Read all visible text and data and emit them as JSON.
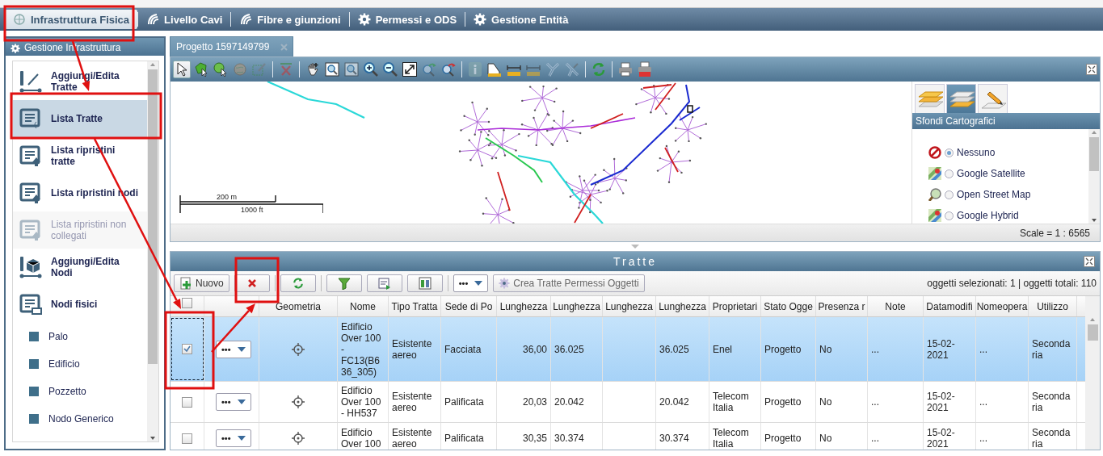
{
  "nav": {
    "items": [
      {
        "label": "Infrastruttura Fisica",
        "kind": "network",
        "selected": true
      },
      {
        "label": "Livello Cavi",
        "kind": "cable",
        "selected": false
      },
      {
        "label": "Fibre e giunzioni",
        "kind": "cable",
        "selected": false
      },
      {
        "label": "Permessi e ODS",
        "kind": "gear",
        "selected": false
      },
      {
        "label": "Gestione Entità",
        "kind": "gear",
        "selected": false
      }
    ]
  },
  "sidebar": {
    "title": "Gestione Infrastruttura",
    "items": [
      {
        "label": "Aggiungi/Edita Tratte",
        "kind": "edit-line",
        "selected": false,
        "disabled": false
      },
      {
        "label": "Lista Tratte",
        "kind": "list",
        "selected": true,
        "disabled": false
      },
      {
        "label": "Lista ripristini tratte",
        "kind": "list-up",
        "selected": false,
        "disabled": false
      },
      {
        "label": "Lista ripristini nodi",
        "kind": "list-up",
        "selected": false,
        "disabled": false
      },
      {
        "label": "Lista ripristini non collegati",
        "kind": "list-up",
        "selected": false,
        "disabled": true
      },
      {
        "label": "Aggiungi/Edita Nodi",
        "kind": "edit-node",
        "selected": false,
        "disabled": false
      },
      {
        "label": "Nodi fisici",
        "kind": "list-box",
        "selected": false,
        "disabled": false
      },
      {
        "label": "Palo",
        "kind": "node-type",
        "selected": false,
        "disabled": false
      },
      {
        "label": "Edificio",
        "kind": "node-type",
        "selected": false,
        "disabled": false
      },
      {
        "label": "Pozzetto",
        "kind": "node-type",
        "selected": false,
        "disabled": false
      },
      {
        "label": "Nodo Generico",
        "kind": "node-type",
        "selected": false,
        "disabled": false
      }
    ]
  },
  "map": {
    "tab": {
      "label": "Progetto 1597149799"
    },
    "tool_groups": [
      [
        {
          "kind": "pointer",
          "selected": true,
          "disabled": false
        },
        {
          "kind": "select-polygon",
          "selected": false,
          "disabled": false
        },
        {
          "kind": "select-circle",
          "selected": false,
          "disabled": false
        },
        {
          "kind": "globe",
          "selected": false,
          "disabled": true
        },
        {
          "kind": "brush",
          "selected": false,
          "disabled": true
        }
      ],
      [
        {
          "kind": "clear",
          "selected": false,
          "disabled": true
        }
      ],
      [
        {
          "kind": "hand",
          "selected": false,
          "disabled": false
        },
        {
          "kind": "zoom-box",
          "selected": false,
          "disabled": false
        },
        {
          "kind": "zoom-box",
          "selected": false,
          "disabled": true
        },
        {
          "kind": "zoom-in",
          "selected": false,
          "disabled": false
        },
        {
          "kind": "zoom-out",
          "selected": false,
          "disabled": false
        },
        {
          "kind": "expand",
          "selected": false,
          "disabled": false
        },
        {
          "kind": "prev",
          "selected": false,
          "disabled": true
        },
        {
          "kind": "next",
          "selected": false,
          "disabled": false
        }
      ],
      [
        {
          "kind": "info",
          "selected": false,
          "disabled": true
        },
        {
          "kind": "area",
          "selected": false,
          "disabled": false
        },
        {
          "kind": "ruler",
          "selected": false,
          "disabled": false
        },
        {
          "kind": "ruler",
          "selected": false,
          "disabled": true
        },
        {
          "kind": "branch",
          "selected": false,
          "disabled": true
        },
        {
          "kind": "branch2",
          "selected": false,
          "disabled": true
        }
      ],
      [
        {
          "kind": "refresh",
          "selected": false,
          "disabled": false
        }
      ],
      [
        {
          "kind": "printer",
          "selected": false,
          "disabled": false
        },
        {
          "kind": "pdf",
          "selected": false,
          "disabled": false
        }
      ]
    ],
    "scale_bar": {
      "top": "200 m",
      "bottom": "1000 ft"
    },
    "scale": "Scale = 1 : 6565",
    "layers": {
      "tabs": [
        {
          "kind": "layers",
          "selected": false
        },
        {
          "kind": "basemaps",
          "selected": true
        },
        {
          "kind": "edit",
          "selected": false
        }
      ],
      "title": "Sfondi Cartografici",
      "basemaps": [
        {
          "label": "Nessuno",
          "kind": "none",
          "selected": true
        },
        {
          "label": "Google Satellite",
          "kind": "map",
          "selected": false
        },
        {
          "label": "Open Street Map",
          "kind": "search-map",
          "selected": false
        },
        {
          "label": "Google Hybrid",
          "kind": "map",
          "selected": false
        }
      ]
    }
  },
  "grid": {
    "title": "Tratte",
    "toolbar": {
      "new_label": "Nuovo",
      "menu_label": "•••",
      "create_label": "Crea Tratte Permessi Oggetti"
    },
    "status": "oggetti selezionati: 1 | oggetti totali: 110",
    "all_checked": false,
    "columns": [
      "Geometria",
      "Nome",
      "Tipo Tratta",
      "Sede di Po",
      "Lunghezza",
      "Lunghezza",
      "Lunghezza",
      "Lunghezza",
      "Proprietari",
      "Stato Ogge",
      "Presenza r",
      "Note",
      "Datamodifi",
      "Nomeopera",
      "Utilizzo"
    ],
    "rows": [
      {
        "selected": true,
        "checked": true,
        "menu": "•••",
        "cells": [
          "",
          "Edificio Over 100 - FC13(B636_305)",
          "Esistente aereo",
          "Facciata",
          "36,00",
          "36.025",
          "",
          "36.025",
          "Enel",
          "Progetto",
          "No",
          "...",
          "15-02-2021",
          "...",
          "Secondaria"
        ]
      },
      {
        "selected": false,
        "checked": false,
        "menu": "•••",
        "cells": [
          "",
          "Edificio Over 100 - HH537",
          "Esistente aereo",
          "Palificata",
          "20,03",
          "20.042",
          "",
          "20.042",
          "Telecom Italia",
          "Progetto",
          "No",
          "...",
          "15-02-2021",
          "...",
          "Secondaria"
        ]
      },
      {
        "selected": false,
        "checked": false,
        "menu": "•••",
        "cells": [
          "",
          "Edificio Over 100",
          "Esistente aereo",
          "Palificata",
          "30,35",
          "30.374",
          "",
          "30.374",
          "Telecom Italia",
          "Progetto",
          "No",
          "...",
          "15-02-2021",
          "...",
          "Secondaria"
        ]
      }
    ]
  }
}
